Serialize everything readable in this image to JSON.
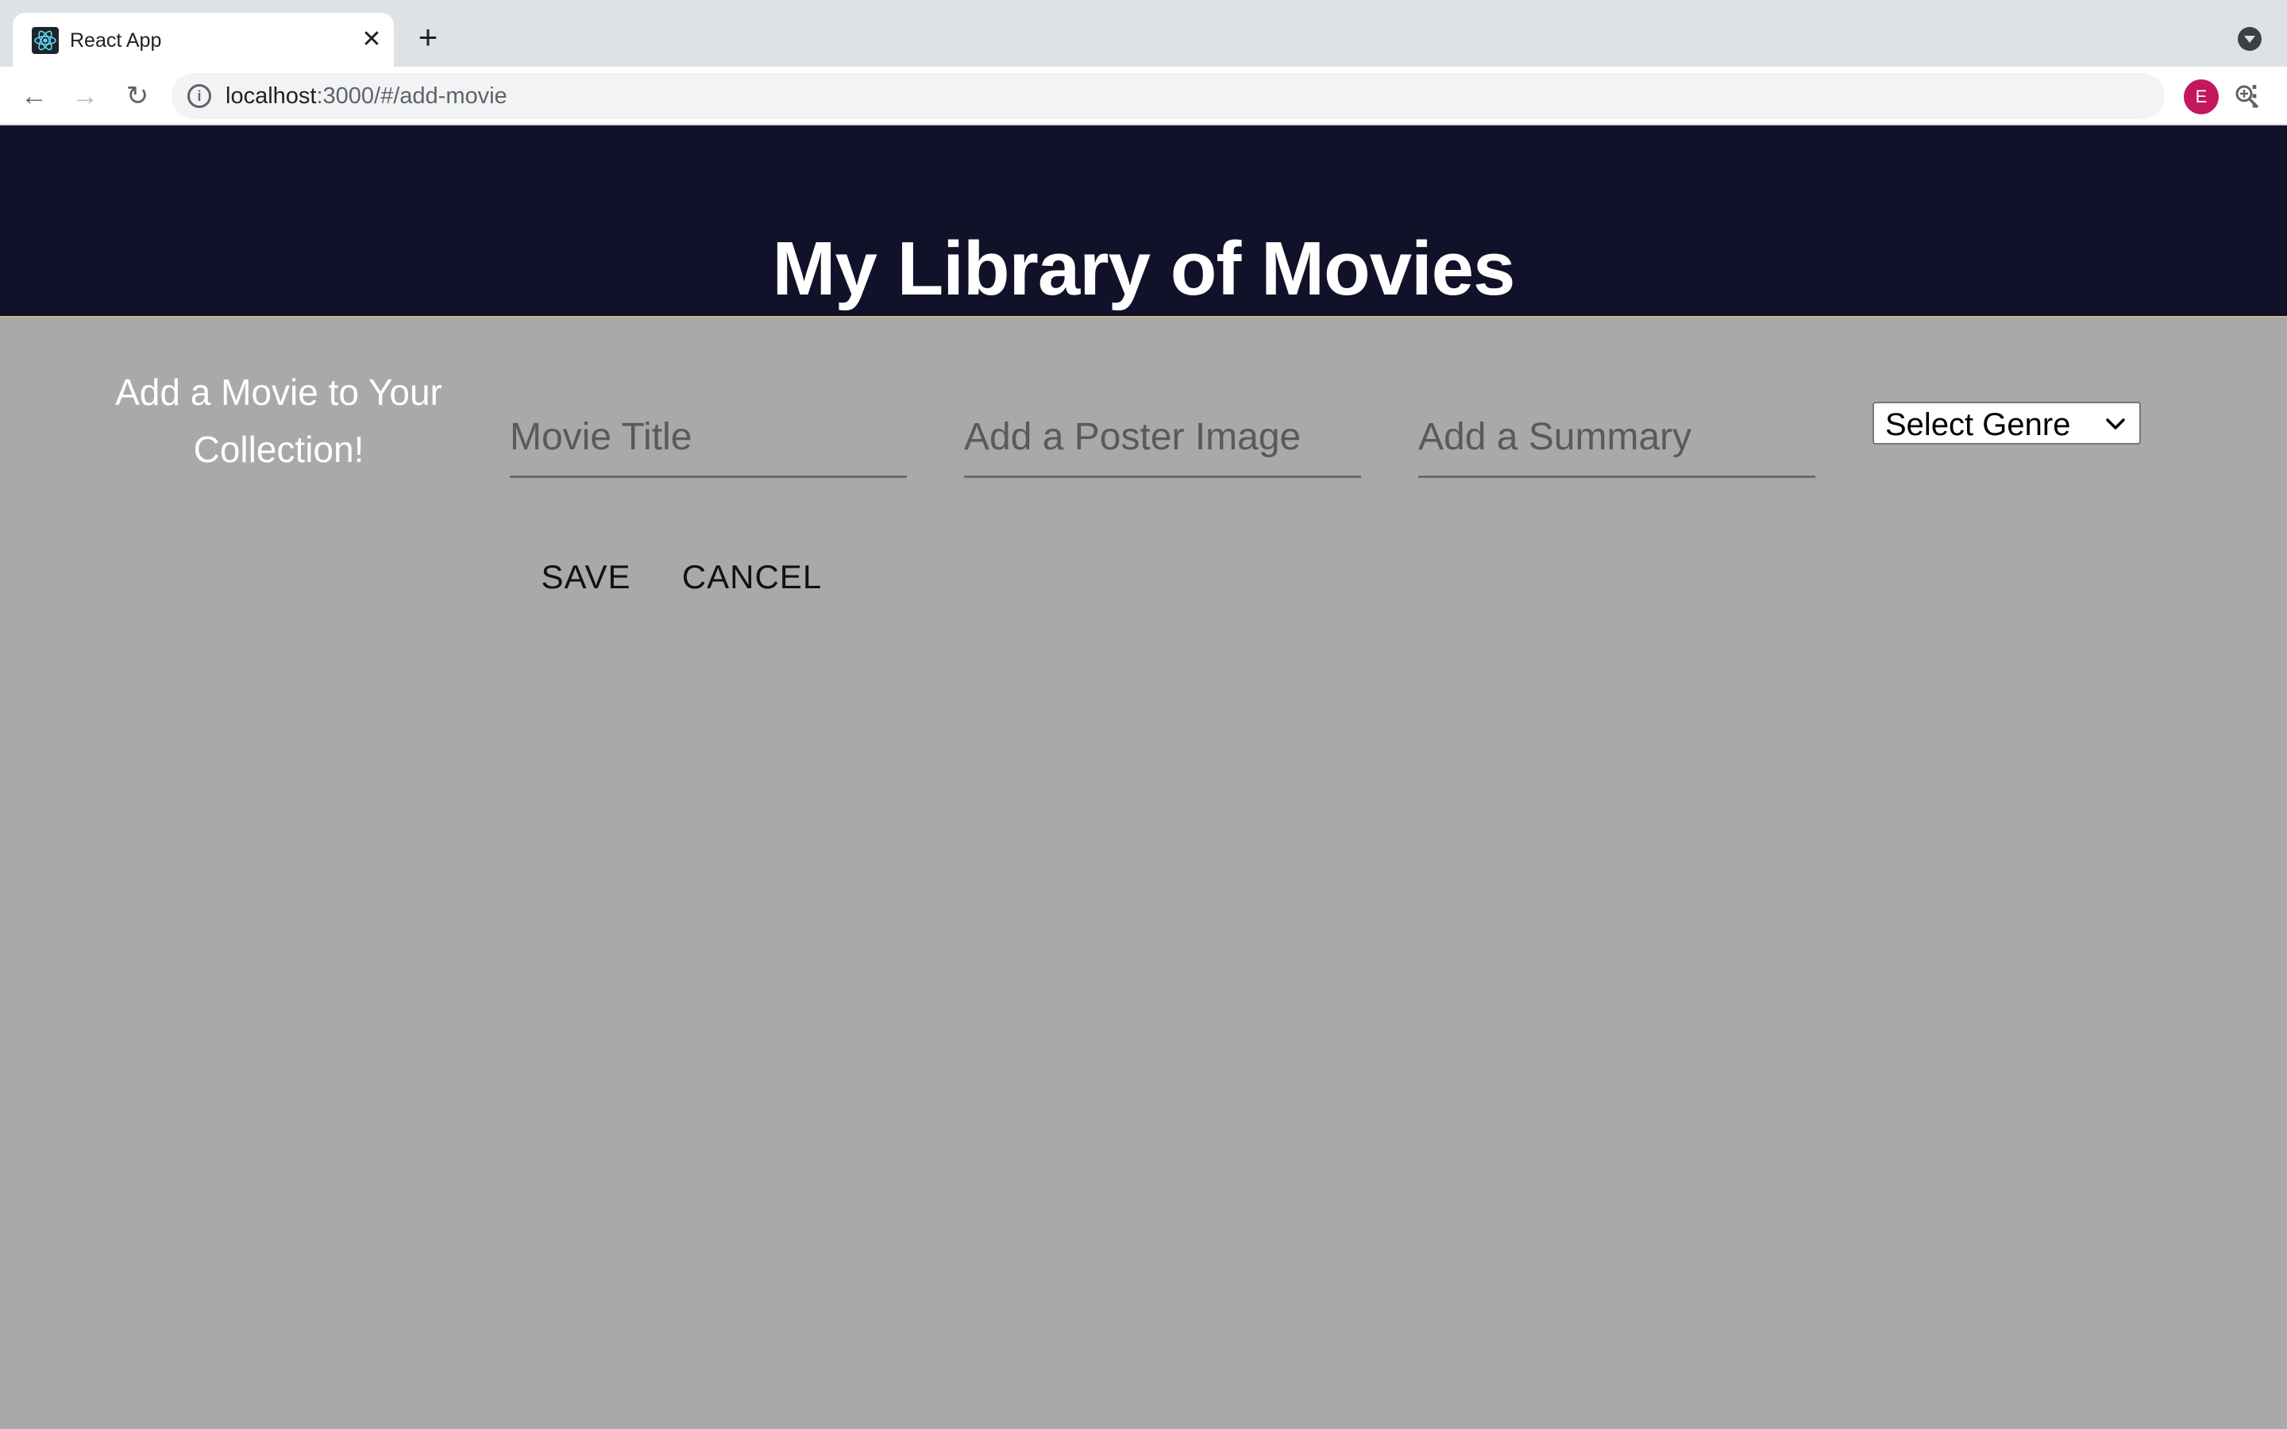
{
  "browser": {
    "tab_title": "React App",
    "favicon_icon": "react-logo-icon",
    "url_host": "localhost",
    "url_path": ":3000/#/add-movie",
    "profile_initial": "E",
    "profile_color": "#c2185b"
  },
  "header": {
    "title": "My Library of Movies",
    "background": "#11112a"
  },
  "form": {
    "heading": "Add a Movie to Your Collection!",
    "title_placeholder": "Movie Title",
    "poster_placeholder": "Add a Poster Image",
    "summary_placeholder": "Add a Summary",
    "genre_selected": "Select Genre",
    "save_label": "SAVE",
    "cancel_label": "CANCEL",
    "background": "#a9a9a9"
  }
}
